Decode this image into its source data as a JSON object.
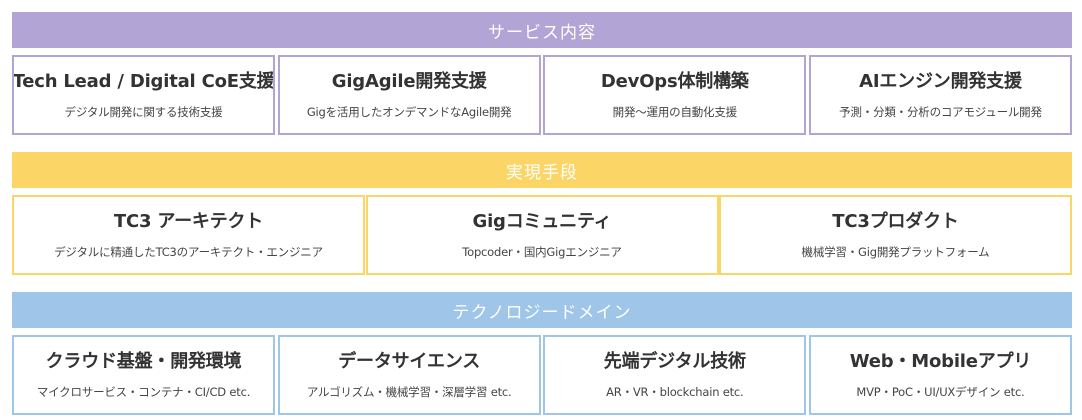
{
  "sections": [
    {
      "title": "サービス内容",
      "color": "#b3a4d6",
      "items": [
        {
          "title": "Tech Lead / Digital CoE支援",
          "subtitle": "デジタル開発に関する技術支援"
        },
        {
          "title": "GigAgile開発支援",
          "subtitle": "Gigを活用したオンデマンドなAgile開発"
        },
        {
          "title": "DevOps体制構築",
          "subtitle": "開発〜運用の自動化支援"
        },
        {
          "title": "AIエンジン開発支援",
          "subtitle": "予測・分類・分析のコアモジュール開発"
        }
      ]
    },
    {
      "title": "実現手段",
      "color": "#fbd565",
      "items": [
        {
          "title": "TC3 アーキテクト",
          "subtitle": "デジタルに精通したTC3のアーキテクト・エンジニア"
        },
        {
          "title": "Gigコミュニティ",
          "subtitle": "Topcoder・国内Gigエンジニア"
        },
        {
          "title": "TC3プロダクト",
          "subtitle": "機械学習・Gig開発プラットフォーム"
        }
      ]
    },
    {
      "title": "テクノロジードメイン",
      "color": "#9fc5e8",
      "items": [
        {
          "title": "クラウド基盤・開発環境",
          "subtitle": "マイクロサービス・コンテナ・CI/CD etc."
        },
        {
          "title": "データサイエンス",
          "subtitle": "アルゴリズム・機械学習・深層学習 etc."
        },
        {
          "title": "先端デジタル技術",
          "subtitle": "AR・VR・blockchain etc."
        },
        {
          "title": "Web・Mobileアプリ",
          "subtitle": "MVP・PoC・UI/UXデザイン etc."
        }
      ]
    }
  ]
}
